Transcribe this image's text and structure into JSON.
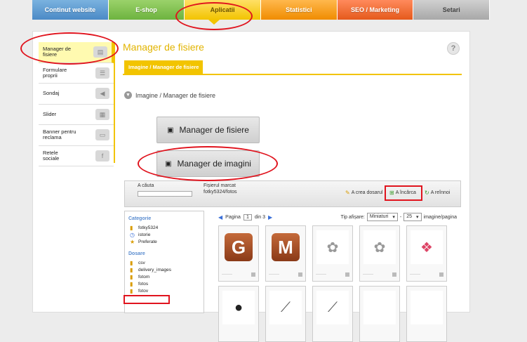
{
  "topnav": [
    "Continut website",
    "E-shop",
    "Aplicatii",
    "Statistici",
    "SEO / Marketing",
    "Setari"
  ],
  "sidebar": [
    {
      "label": "Manager de fisiere",
      "icon": "folder-icon",
      "active": true
    },
    {
      "label": "Formulare proprii",
      "icon": "form-icon"
    },
    {
      "label": "Sondaj",
      "icon": "megaphone-icon"
    },
    {
      "label": "Slider",
      "icon": "image-slider-icon"
    },
    {
      "label": "Banner pentru reclama",
      "icon": "banner-icon"
    },
    {
      "label": "Retele sociale",
      "icon": "social-icon"
    }
  ],
  "title": "Manager de fisiere",
  "help": "?",
  "subtab": "Imagine / Manager de fisiere",
  "crumb": "Imagine / Manager de fisiere",
  "buttons": {
    "files": "Manager de fisiere",
    "images": "Manager de imagini"
  },
  "toolbar": {
    "search_label": "A căuta",
    "marked_label": "Fișierul marcat",
    "marked_path": "fotky5324/fotos",
    "create_folder": "A crea dosarul",
    "upload": "A încărca",
    "refresh": "A reînnoi"
  },
  "leftpane": {
    "cat_head": "Categorie",
    "categories": [
      {
        "label": "fotky5324",
        "icon": "folder-icon"
      },
      {
        "label": "istorie",
        "icon": "clock-icon"
      },
      {
        "label": "Preferate",
        "icon": "star-icon"
      }
    ],
    "dir_head": "Dosare",
    "dirs": [
      "csv",
      "delivery_images",
      "fotom",
      "fotos",
      "fotov"
    ]
  },
  "grid": {
    "page_label": "Pagina",
    "page": "1",
    "of_label": "din 3",
    "view_label": "Tip afișare:",
    "view_value": "Miniaturi",
    "per_page": "25",
    "per_page_label": "imagine/pagina"
  },
  "thumbs": [
    "G",
    "M",
    "",
    "",
    "",
    "",
    "",
    "",
    "",
    ""
  ]
}
